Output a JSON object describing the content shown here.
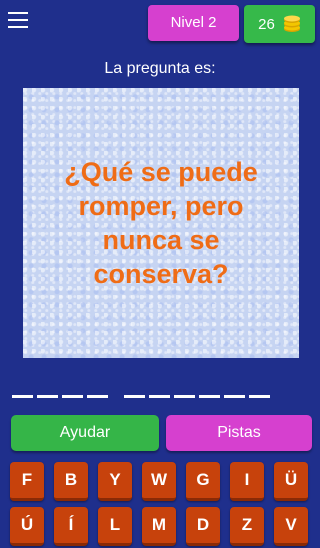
{
  "header": {
    "menu_icon": "hamburger-menu-icon",
    "level_label": "Nivel 2",
    "coins": "26",
    "coin_icon": "coin-stack-icon"
  },
  "question": {
    "label": "La pregunta es:",
    "text": "¿Qué se puede romper, pero nunca se conserva?"
  },
  "answer": {
    "word_lengths": [
      4,
      6
    ]
  },
  "actions": {
    "help_label": "Ayudar",
    "hints_label": "Pistas"
  },
  "keyboard": {
    "row1": [
      "F",
      "B",
      "Y",
      "W",
      "G",
      "I",
      "Ü"
    ],
    "row2": [
      "Ú",
      "Í",
      "L",
      "M",
      "D",
      "Z",
      "V"
    ]
  },
  "colors": {
    "background": "#1f2f8c",
    "level_badge": "#d640cf",
    "coins_badge": "#36b94a",
    "question_text": "#ef6c16",
    "key": "#c7420c"
  }
}
